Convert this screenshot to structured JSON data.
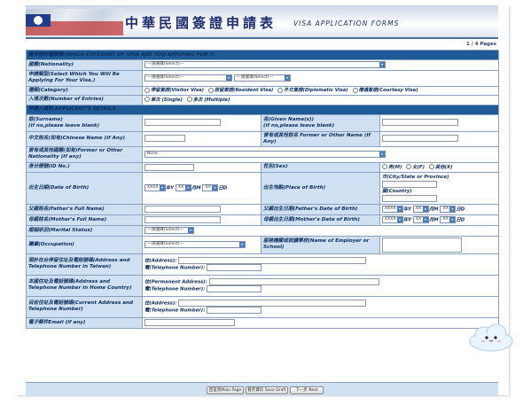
{
  "header": {
    "title_zh": "中華民國簽證申請表",
    "title_en": "VISA APPLICATION FORMS",
    "page_indicator": "1 / 4 Pages"
  },
  "section1": {
    "title": "擬申請何種簽證(WHICH CATEGORY OF VISA ARE YOU APPLYING FOR ?)",
    "nationality": {
      "label": "國籍(Nationality)",
      "value": "---請選擇(Select)---"
    },
    "visa_purpose": {
      "label": "申請類型(Select Which You Will Be Applying For Your Visa.)",
      "value1": "---請選擇(Select)---",
      "value2": "---請選擇(Select)---"
    },
    "category": {
      "label": "種類(Category)",
      "options": [
        "停留簽證(Visitor Visa)",
        "居留簽證(Resident Visa)",
        "外交簽證(Diplomatic Visa)",
        "禮遇簽證(Courtesy Visa)"
      ]
    },
    "entries": {
      "label": "入境次數(Number of Entries)",
      "options": [
        "單次 (Single)",
        "多次 (Multiple)"
      ]
    }
  },
  "section2": {
    "title": "申請人資料 APPLICANT'S DETAILS",
    "surname": "姓(Surname)\n(if no,please leave blank)",
    "given_name": "名(Given Name(s))\n(if no,please leave blank)",
    "chinese_name": "中文姓名(如有)Chinese Name (If Any)",
    "former_name": "曾有或其他姓名 Former or Other Name (If Any)",
    "former_nationality": {
      "label": "曾有或其他國籍(如有)Former or Other Nationality (If any)",
      "value": "None"
    },
    "id_no": "身分證號(ID No.)",
    "sex": {
      "label": "性別(Sex)",
      "options": [
        "男(M)",
        "女(F)",
        "其他(X)"
      ]
    },
    "dob": {
      "label": "出生日期(Date of Birth)",
      "year": "XXXX",
      "month": "XX",
      "day": "XX",
      "y": "年Y",
      "m": "月M",
      "d": "日D"
    },
    "pob": {
      "label": "出生地點(Place of Birth)",
      "city": "市(City/State or Province)",
      "country": "國(Country)"
    },
    "father_name": "父親姓名(Father's Full Name)",
    "father_dob": "父親出生日期(Father's Date of Birth)",
    "mother_name": "母親姓名(Mother's Full Name)",
    "mother_dob": "母親出生日期(Mother's Date of Birth)",
    "marital": {
      "label": "婚姻狀況(Marital Status)",
      "value": "---請選擇(Select)---"
    },
    "occupation": {
      "label": "職業(Occupation)",
      "value": "---請選擇(Select)---"
    },
    "employer": "服務機關或就讀學校(Name of Employer or School)",
    "addr_taiwan": {
      "label": "預計在台停留住址及電話號碼(Address and Telephone Number in Taiwan)",
      "addr": "住(Address):",
      "tel": "電(Telephone Number):"
    },
    "addr_home": {
      "label": "本國住址及電話號碼(Address and Telephone Number in Home Country)",
      "addr": "住(Permanent Address):",
      "tel": "電(Telephone Number):"
    },
    "addr_current": {
      "label": "目前住址及電話號碼(Current Address and Telephone Number)",
      "addr": "住(Address):",
      "tel": "電(Telephone Number):"
    },
    "email": "電子郵件Email (if any)"
  },
  "footer": {
    "main_page": "回首頁Main Page",
    "save_draft": "暫存資料 Save Draft",
    "next": "下一步 Next"
  }
}
